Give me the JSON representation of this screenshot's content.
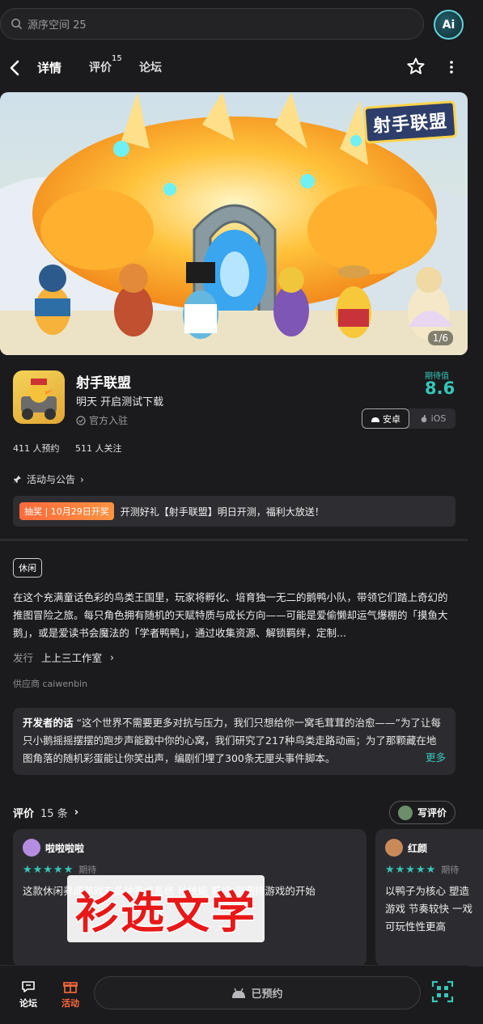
{
  "search": {
    "placeholder": "源序空间 25"
  },
  "ai_button": {
    "label": "Ai"
  },
  "nav": {
    "tabs": [
      {
        "label": "详情",
        "active": true
      },
      {
        "label": "评价",
        "count": "15"
      },
      {
        "label": "论坛"
      }
    ]
  },
  "hero": {
    "logo_text": "射手联盟",
    "counter": "1/6"
  },
  "game": {
    "name": "射手联盟",
    "schedule": "明天 开启测试下载",
    "official": "官方入驻",
    "rating_label": "期待值",
    "rating_value": "8.6",
    "platforms": [
      {
        "label": "安卓",
        "active": true
      },
      {
        "label": "iOS",
        "active": false
      }
    ],
    "reservations": "411 人预约",
    "followers": "511 人关注"
  },
  "announcements": {
    "link_label": "活动与公告",
    "promo_tag": "抽奖 | 10月29日开奖",
    "promo_text": "开测好礼【射手联盟】明日开测，福利大放送！"
  },
  "about": {
    "genre_tag": "休闲",
    "description": "在这个充满童话色彩的鸟类王国里，玩家将孵化、培育独一无二的鹅鸭小队，带领它们踏上奇幻的推图冒险之旅。每只角色拥有随机的天赋特质与成长方向——可能是爱偷懒却运气爆棚的「摸鱼大鹅」，或是爱读书会魔法的「学者鸭鸭」，通过收集资源、解锁羁绊，定制...",
    "publisher_label": "发行",
    "publisher_name": "上上三工作室",
    "supplier": "供应商 caiwenbin"
  },
  "developer_note": {
    "label": "开发者的话",
    "text": "“这个世界不需要更多对抗与压力，我们只想给你一窝毛茸茸的治愈——”为了让每只小鹅摇摇摆摆的跑步声能戳中你的心窝，我们研究了217种鸟类走路动画；为了那颗藏在地图角落的随机彩蛋能让你笑出声，编剧们埋了300条无厘头事件脚本。",
    "more_label": "更多"
  },
  "reviews": {
    "title": "评价",
    "count": "15 条",
    "write_label": "写评价",
    "items": [
      {
        "name": "啦啦啦啦",
        "stars": "★★★★★",
        "tag": "期待",
        "text": "这款休闲养成游戏有多种养成系统 种技能 羁绊 很期待游戏的开始"
      },
      {
        "name": "红颜",
        "stars": "★★★★★",
        "tag": "期待",
        "text": "以鸭子为核心 塑造游戏 节奏较快 一戏可玩性性更高"
      }
    ]
  },
  "watermark": {
    "text": "衫选文学"
  },
  "bottom": {
    "forum_label": "论坛",
    "activity_label": "活动",
    "reserve_label": "已预约"
  },
  "colors": {
    "accent": "#35c7b9",
    "promo": "#ff6a3c",
    "background": "#1b1b1d"
  }
}
